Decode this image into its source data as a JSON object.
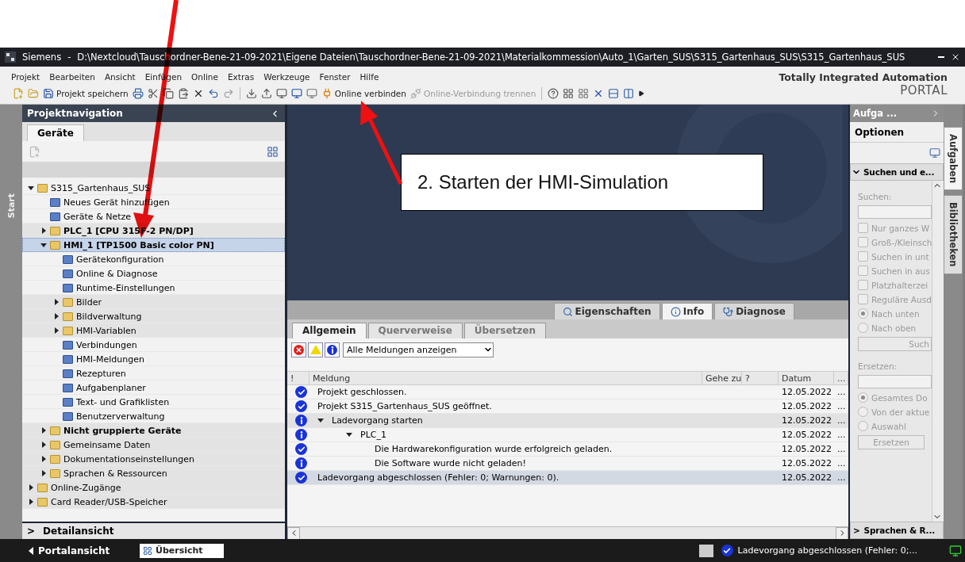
{
  "window": {
    "app": "Siemens",
    "separator": "-",
    "path": "D:\\Nextcloud\\Tauschordner-Bene-21-09-2021\\Eigene Dateien\\Tauschordner-Bene-21-09-2021\\Materialkommession\\Auto_1\\Garten_SUS\\S315_Gartenhaus_SUS\\S315_Gartenhaus_SUS"
  },
  "menu": [
    "Projekt",
    "Bearbeiten",
    "Ansicht",
    "Einfügen",
    "Online",
    "Extras",
    "Werkzeuge",
    "Fenster",
    "Hilfe"
  ],
  "toolbar": {
    "save": "Projekt speichern",
    "connect": {
      "label": "Online verbinden",
      "disabled": false
    },
    "disconnect": {
      "label": "Online-Verbindung trennen",
      "disabled": true
    }
  },
  "brand": {
    "line1": "Totally Integrated Automation",
    "line2": "PORTAL"
  },
  "start_tab": "Start",
  "project_nav": {
    "title": "Projektnavigation",
    "tab": "Geräte",
    "tree": [
      {
        "label": "S315_Gartenhaus_SUS",
        "expanded": true,
        "bold": false,
        "selected": false,
        "children": [
          {
            "label": "Neues Gerät hinzufügen",
            "bold": false,
            "selected": false
          },
          {
            "label": "Geräte & Netze",
            "bold": false,
            "selected": false
          },
          {
            "label": "PLC_1 [CPU 315F-2 PN/DP]",
            "expanded": false,
            "bold": true,
            "selected": false
          },
          {
            "label": "HMI_1 [TP1500 Basic color PN]",
            "expanded": true,
            "bold": true,
            "selected": true,
            "children": [
              {
                "label": "Gerätekonfiguration",
                "bold": false,
                "selected": false
              },
              {
                "label": "Online & Diagnose",
                "bold": false,
                "selected": false
              },
              {
                "label": "Runtime-Einstellungen",
                "bold": false,
                "selected": false
              },
              {
                "label": "Bilder",
                "expanded": false,
                "bold": false,
                "selected": false
              },
              {
                "label": "Bildverwaltung",
                "expanded": false,
                "bold": false,
                "selected": false
              },
              {
                "label": "HMI-Variablen",
                "expanded": false,
                "bold": false,
                "selected": false
              },
              {
                "label": "Verbindungen",
                "bold": false,
                "selected": false
              },
              {
                "label": "HMI-Meldungen",
                "bold": false,
                "selected": false
              },
              {
                "label": "Rezepturen",
                "bold": false,
                "selected": false
              },
              {
                "label": "Aufgabenplaner",
                "bold": false,
                "selected": false
              },
              {
                "label": "Text- und Grafiklisten",
                "bold": false,
                "selected": false
              },
              {
                "label": "Benutzerverwaltung",
                "bold": false,
                "selected": false
              }
            ]
          },
          {
            "label": "Nicht gruppierte Geräte",
            "expanded": false,
            "bold": true,
            "selected": false
          },
          {
            "label": "Gemeinsame Daten",
            "expanded": false,
            "bold": false,
            "selected": false
          },
          {
            "label": "Dokumentationseinstellungen",
            "expanded": false,
            "bold": false,
            "selected": false
          },
          {
            "label": "Sprachen & Ressourcen",
            "expanded": false,
            "bold": false,
            "selected": false
          }
        ]
      },
      {
        "label": "Online-Zugänge",
        "expanded": false,
        "bold": false,
        "selected": false
      },
      {
        "label": "Card Reader/USB-Speicher",
        "expanded": false,
        "bold": false,
        "selected": false
      }
    ],
    "detail": {
      "toggle": ">",
      "title": "Detailansicht"
    }
  },
  "inspector": {
    "tabs": [
      {
        "label": "Eigenschaften",
        "selected": false
      },
      {
        "label": "Info",
        "selected": true
      },
      {
        "label": "Diagnose",
        "selected": false
      }
    ],
    "subtabs": [
      {
        "label": "Allgemein",
        "selected": true
      },
      {
        "label": "Querverweise",
        "selected": false
      },
      {
        "label": "Übersetzen",
        "selected": false
      }
    ],
    "filter": "Alle Meldungen anzeigen",
    "columns": [
      "!",
      "Meldung",
      "Gehe zu",
      "?",
      "Datum",
      "..."
    ],
    "rows": [
      {
        "kind": "success",
        "text": "Projekt geschlossen.",
        "date": "12.05.2022",
        "more": "...",
        "selected": false
      },
      {
        "kind": "success",
        "text": "Projekt S315_Gartenhaus_SUS geöffnet.",
        "date": "12.05.2022",
        "more": "...",
        "selected": false
      },
      {
        "kind": "info",
        "text": "Ladevorgang starten",
        "date": "12.05.2022",
        "more": "...",
        "selected": false,
        "expanded": true,
        "children": [
          {
            "kind": "info",
            "text": "PLC_1",
            "date": "12.05.2022",
            "more": "...",
            "selected": false,
            "expanded": true,
            "children": [
              {
                "kind": "success",
                "text": "Die Hardwarekonfiguration wurde erfolgreich geladen.",
                "date": "12.05.2022",
                "more": "...",
                "selected": false
              },
              {
                "kind": "info",
                "text": "Die Software wurde nicht geladen!",
                "date": "12.05.2022",
                "more": "...",
                "selected": false
              }
            ]
          }
        ]
      },
      {
        "kind": "success",
        "text": "Ladevorgang abgeschlossen (Fehler: 0; Warnungen: 0).",
        "date": "12.05.2022",
        "more": "...",
        "selected": true
      }
    ]
  },
  "tasks": {
    "title": "Aufga ...",
    "options": "Optionen",
    "section": "Suchen und e...",
    "search_label": "Suchen:",
    "checks": [
      {
        "label": "Nur ganzes W",
        "checked": false
      },
      {
        "label": "Groß-/Kleinsch",
        "checked": false
      },
      {
        "label": "Suchen in unt",
        "checked": false
      },
      {
        "label": "Suchen in aus",
        "checked": false
      },
      {
        "label": "Platzhalterzei",
        "checked": false
      },
      {
        "label": "Reguläre Ausd",
        "checked": false
      }
    ],
    "direction": [
      {
        "label": "Nach unten",
        "selected": true
      },
      {
        "label": "Nach oben",
        "selected": false
      }
    ],
    "search_button": "Such",
    "replace_label": "Ersetzen:",
    "scope": [
      {
        "label": "Gesamtes Do",
        "selected": true
      },
      {
        "label": "Von der aktue",
        "selected": false
      },
      {
        "label": "Auswahl",
        "selected": false
      }
    ],
    "replace_button": "Ersetzen",
    "section2": "Sprachen & R...",
    "section2_toggle": ">",
    "side_tabs": [
      {
        "label": "Aufgaben",
        "selected": true
      },
      {
        "label": "Bibliotheken",
        "selected": false
      }
    ]
  },
  "status_bar": {
    "portal": "Portalansicht",
    "overview": "Übersicht",
    "message": "Ladevorgang abgeschlossen (Fehler: 0;..."
  },
  "annotation": {
    "callout": "2. Starten der HMI-Simulation"
  }
}
